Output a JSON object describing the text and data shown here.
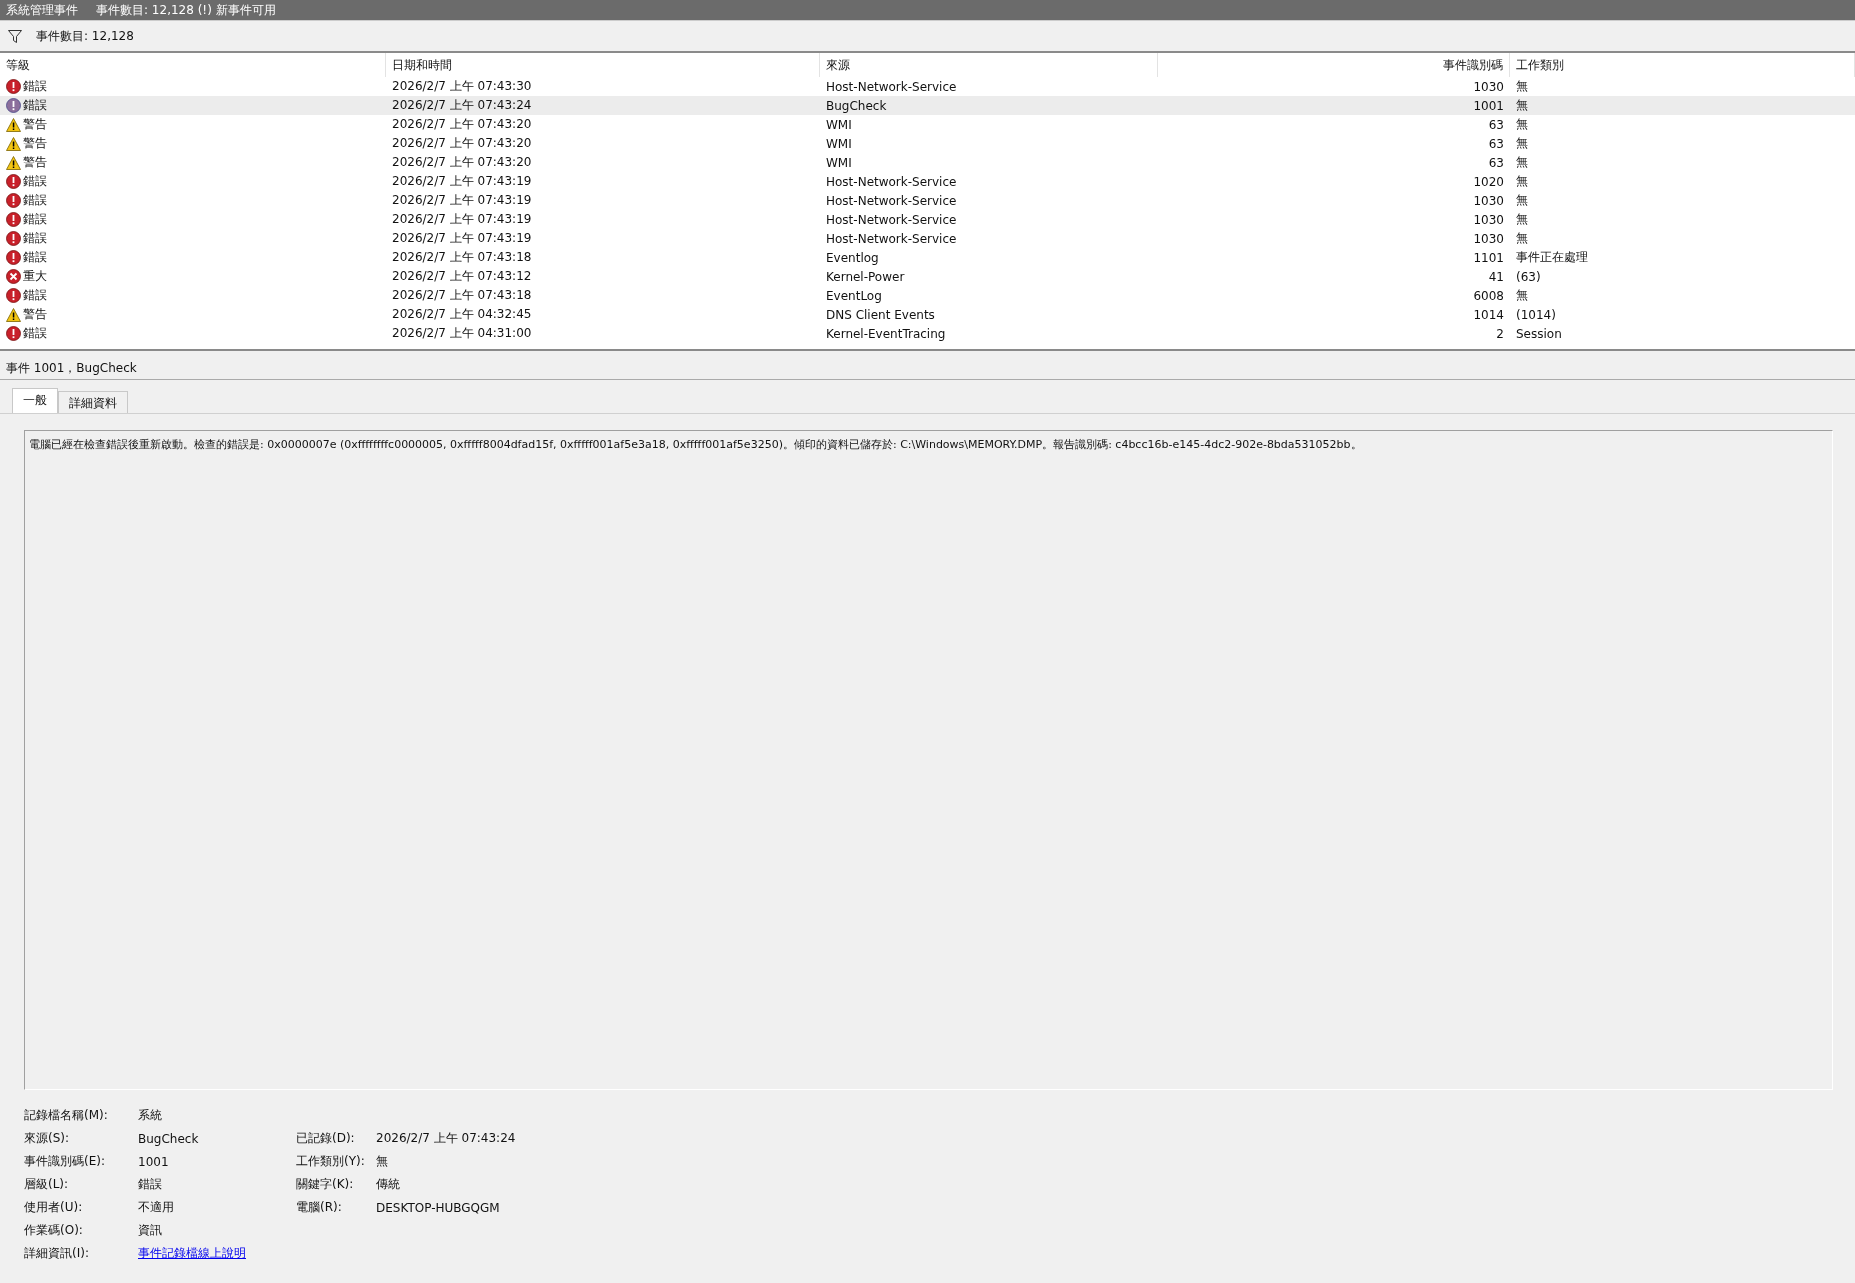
{
  "title_bar": {
    "title": "系統管理事件",
    "status": "事件數目: 12,128 (!) 新事件可用"
  },
  "filter_bar": {
    "text": "事件數目: 12,128"
  },
  "table": {
    "columns": [
      "等級",
      "日期和時間",
      "來源",
      "事件識別碼",
      "工作類別"
    ],
    "rows": [
      {
        "kind": "error",
        "level": "錯誤",
        "datetime": "2026/2/7 上午 07:43:30",
        "source": "Host-Network-Service",
        "event_id": "1030",
        "task": "無",
        "selected": false
      },
      {
        "kind": "error",
        "level": "錯誤",
        "datetime": "2026/2/7 上午 07:43:24",
        "source": "BugCheck",
        "event_id": "1001",
        "task": "無",
        "selected": true
      },
      {
        "kind": "warning",
        "level": "警告",
        "datetime": "2026/2/7 上午 07:43:20",
        "source": "WMI",
        "event_id": "63",
        "task": "無",
        "selected": false
      },
      {
        "kind": "warning",
        "level": "警告",
        "datetime": "2026/2/7 上午 07:43:20",
        "source": "WMI",
        "event_id": "63",
        "task": "無",
        "selected": false
      },
      {
        "kind": "warning",
        "level": "警告",
        "datetime": "2026/2/7 上午 07:43:20",
        "source": "WMI",
        "event_id": "63",
        "task": "無",
        "selected": false
      },
      {
        "kind": "error",
        "level": "錯誤",
        "datetime": "2026/2/7 上午 07:43:19",
        "source": "Host-Network-Service",
        "event_id": "1020",
        "task": "無",
        "selected": false
      },
      {
        "kind": "error",
        "level": "錯誤",
        "datetime": "2026/2/7 上午 07:43:19",
        "source": "Host-Network-Service",
        "event_id": "1030",
        "task": "無",
        "selected": false
      },
      {
        "kind": "error",
        "level": "錯誤",
        "datetime": "2026/2/7 上午 07:43:19",
        "source": "Host-Network-Service",
        "event_id": "1030",
        "task": "無",
        "selected": false
      },
      {
        "kind": "error",
        "level": "錯誤",
        "datetime": "2026/2/7 上午 07:43:19",
        "source": "Host-Network-Service",
        "event_id": "1030",
        "task": "無",
        "selected": false
      },
      {
        "kind": "error",
        "level": "錯誤",
        "datetime": "2026/2/7 上午 07:43:18",
        "source": "Eventlog",
        "event_id": "1101",
        "task": "事件正在處理",
        "selected": false
      },
      {
        "kind": "critical",
        "level": "重大",
        "datetime": "2026/2/7 上午 07:43:12",
        "source": "Kernel-Power",
        "event_id": "41",
        "task": "(63)",
        "selected": false
      },
      {
        "kind": "error",
        "level": "錯誤",
        "datetime": "2026/2/7 上午 07:43:18",
        "source": "EventLog",
        "event_id": "6008",
        "task": "無",
        "selected": false
      },
      {
        "kind": "warning",
        "level": "警告",
        "datetime": "2026/2/7 上午 04:32:45",
        "source": "DNS Client Events",
        "event_id": "1014",
        "task": "(1014)",
        "selected": false
      },
      {
        "kind": "error",
        "level": "錯誤",
        "datetime": "2026/2/7 上午 04:31:00",
        "source": "Kernel-EventTracing",
        "event_id": "2",
        "task": "Session",
        "selected": false
      }
    ]
  },
  "event_title": "事件 1001，BugCheck",
  "tabs": [
    {
      "label": "一般",
      "selected": true
    },
    {
      "label": "詳細資料",
      "selected": false
    }
  ],
  "description": "電腦已經在檢查錯誤後重新啟動。檢查的錯誤是: 0x0000007e (0xffffffffc0000005, 0xfffff8004dfad15f, 0xfffff001af5e3a18, 0xfffff001af5e3250)。傾印的資料已儲存於: C:\\Windows\\MEMORY.DMP。報告識別碼: c4bcc16b-e145-4dc2-902e-8bda531052bb。",
  "properties": {
    "left": [
      {
        "label": "記錄檔名稱(M):",
        "value": "系統"
      },
      {
        "label": "來源(S):",
        "value": "BugCheck"
      },
      {
        "label": "事件識別碼(E):",
        "value": "1001"
      },
      {
        "label": "層級(L):",
        "value": "錯誤"
      },
      {
        "label": "使用者(U):",
        "value": "不適用"
      },
      {
        "label": "作業碼(O):",
        "value": "資訊"
      },
      {
        "label": "詳細資訊(I):",
        "value": "事件記錄檔線上說明",
        "kind": "link"
      }
    ],
    "right": [
      {
        "label": "已記錄(D):",
        "value": "2026/2/7 上午 07:43:24"
      },
      {
        "label": "工作類別(Y):",
        "value": "無"
      },
      {
        "label": "關鍵字(K):",
        "value": "傳統"
      },
      {
        "label": "電腦(R):",
        "value": "DESKTOP-HUBGQGM"
      }
    ]
  }
}
